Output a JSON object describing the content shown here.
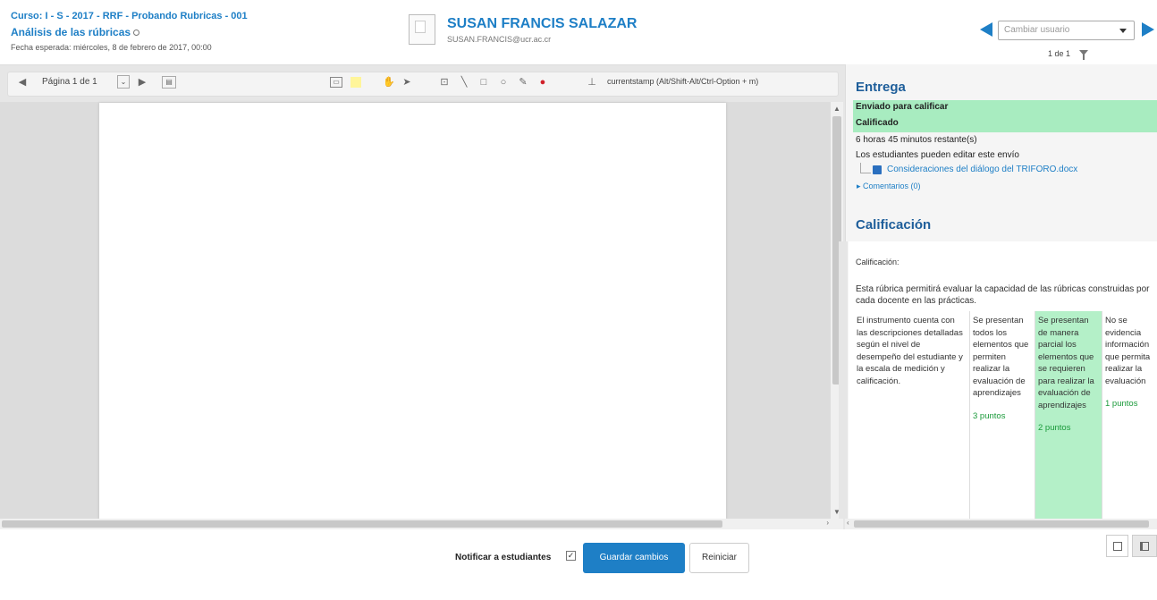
{
  "header": {
    "course": "Curso: I - S - 2017 - RRF - Probando Rubricas - 001",
    "assignment": "Análisis de las rúbricas",
    "due": "Fecha esperada: miércoles, 8 de febrero de 2017, 00:00",
    "user_name": "SUSAN FRANCIS SALAZAR",
    "user_email": "SUSAN.FRANCIS@ucr.ac.cr",
    "user_select_placeholder": "Cambiar usuario",
    "user_count": "1 de 1"
  },
  "toolbar": {
    "page_label": "Página 1 de 1",
    "stamp_label": "currentstamp (Alt/Shift-Alt/Ctrl-Option + m)"
  },
  "side": {
    "submission_heading": "Entrega",
    "status_submitted": "Enviado para calificar",
    "status_graded": "Calificado",
    "time_remaining": "6 horas 45 minutos restante(s)",
    "can_edit": "Los estudiantes pueden editar este envío",
    "file_name": "Consideraciones del diálogo del TRIFORO.docx",
    "comments": "Comentarios (0)",
    "grade_heading": "Calificación",
    "grade_label": "Calificación:",
    "rubric_description": "Esta rúbrica permitirá evaluar la capacidad de las rúbricas construidas por cada docente en las prácticas.",
    "criterion": "El instrumento cuenta con las descripciones detalladas según el nivel de desempeño del estudiante y la escala de medición y calificación.",
    "levels": [
      {
        "text": "Se presentan todos los elementos que permiten realizar la evaluación de aprendizajes",
        "points": "3 puntos"
      },
      {
        "text": "Se presentan de manera parcial los elementos que se requieren para realizar la evaluación de aprendizajes",
        "points": "2 puntos"
      },
      {
        "text": "No se evidencia información que permita realizar la evaluación",
        "points": "1 puntos"
      }
    ]
  },
  "footer": {
    "notify_label": "Notificar a estudiantes",
    "save_label": "Guardar cambios",
    "reset_label": "Reiniciar"
  },
  "colors": {
    "accent": "#1e7fc6",
    "status_green": "#a8ecc0",
    "selected_level": "#b4f0c8"
  }
}
